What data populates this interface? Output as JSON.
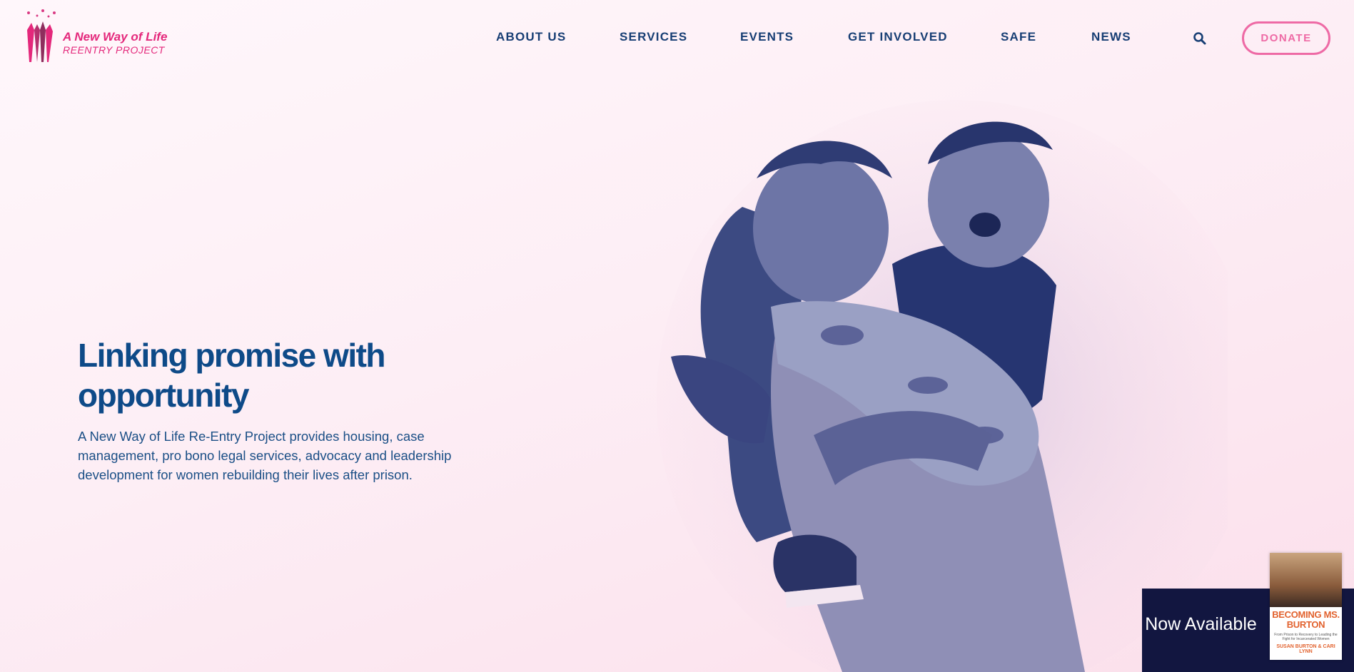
{
  "brand": {
    "name_line1": "A New Way of Life",
    "name_line2": "REENTRY PROJECT",
    "pink": "#e4287b",
    "navy": "#173e74"
  },
  "nav": {
    "items": [
      {
        "label": "ABOUT US"
      },
      {
        "label": "SERVICES"
      },
      {
        "label": "EVENTS"
      },
      {
        "label": "GET INVOLVED"
      },
      {
        "label": "SAFE"
      },
      {
        "label": "NEWS"
      }
    ],
    "search_icon": "search-icon",
    "donate_label": "DONATE"
  },
  "hero": {
    "title": "Linking promise with opportunity",
    "description": "A New Way of Life Re-Entry Project provides housing, case management, pro bono legal services, advocacy and leadership development for women rebuilding their lives after prison."
  },
  "promo": {
    "text": "Now Available",
    "book_title": "BECOMING MS. BURTON",
    "book_subtitle": "From Prison to Recovery to Leading the Fight for Incarcerated Women",
    "book_authors": "SUSAN BURTON & CARI LYNN"
  }
}
